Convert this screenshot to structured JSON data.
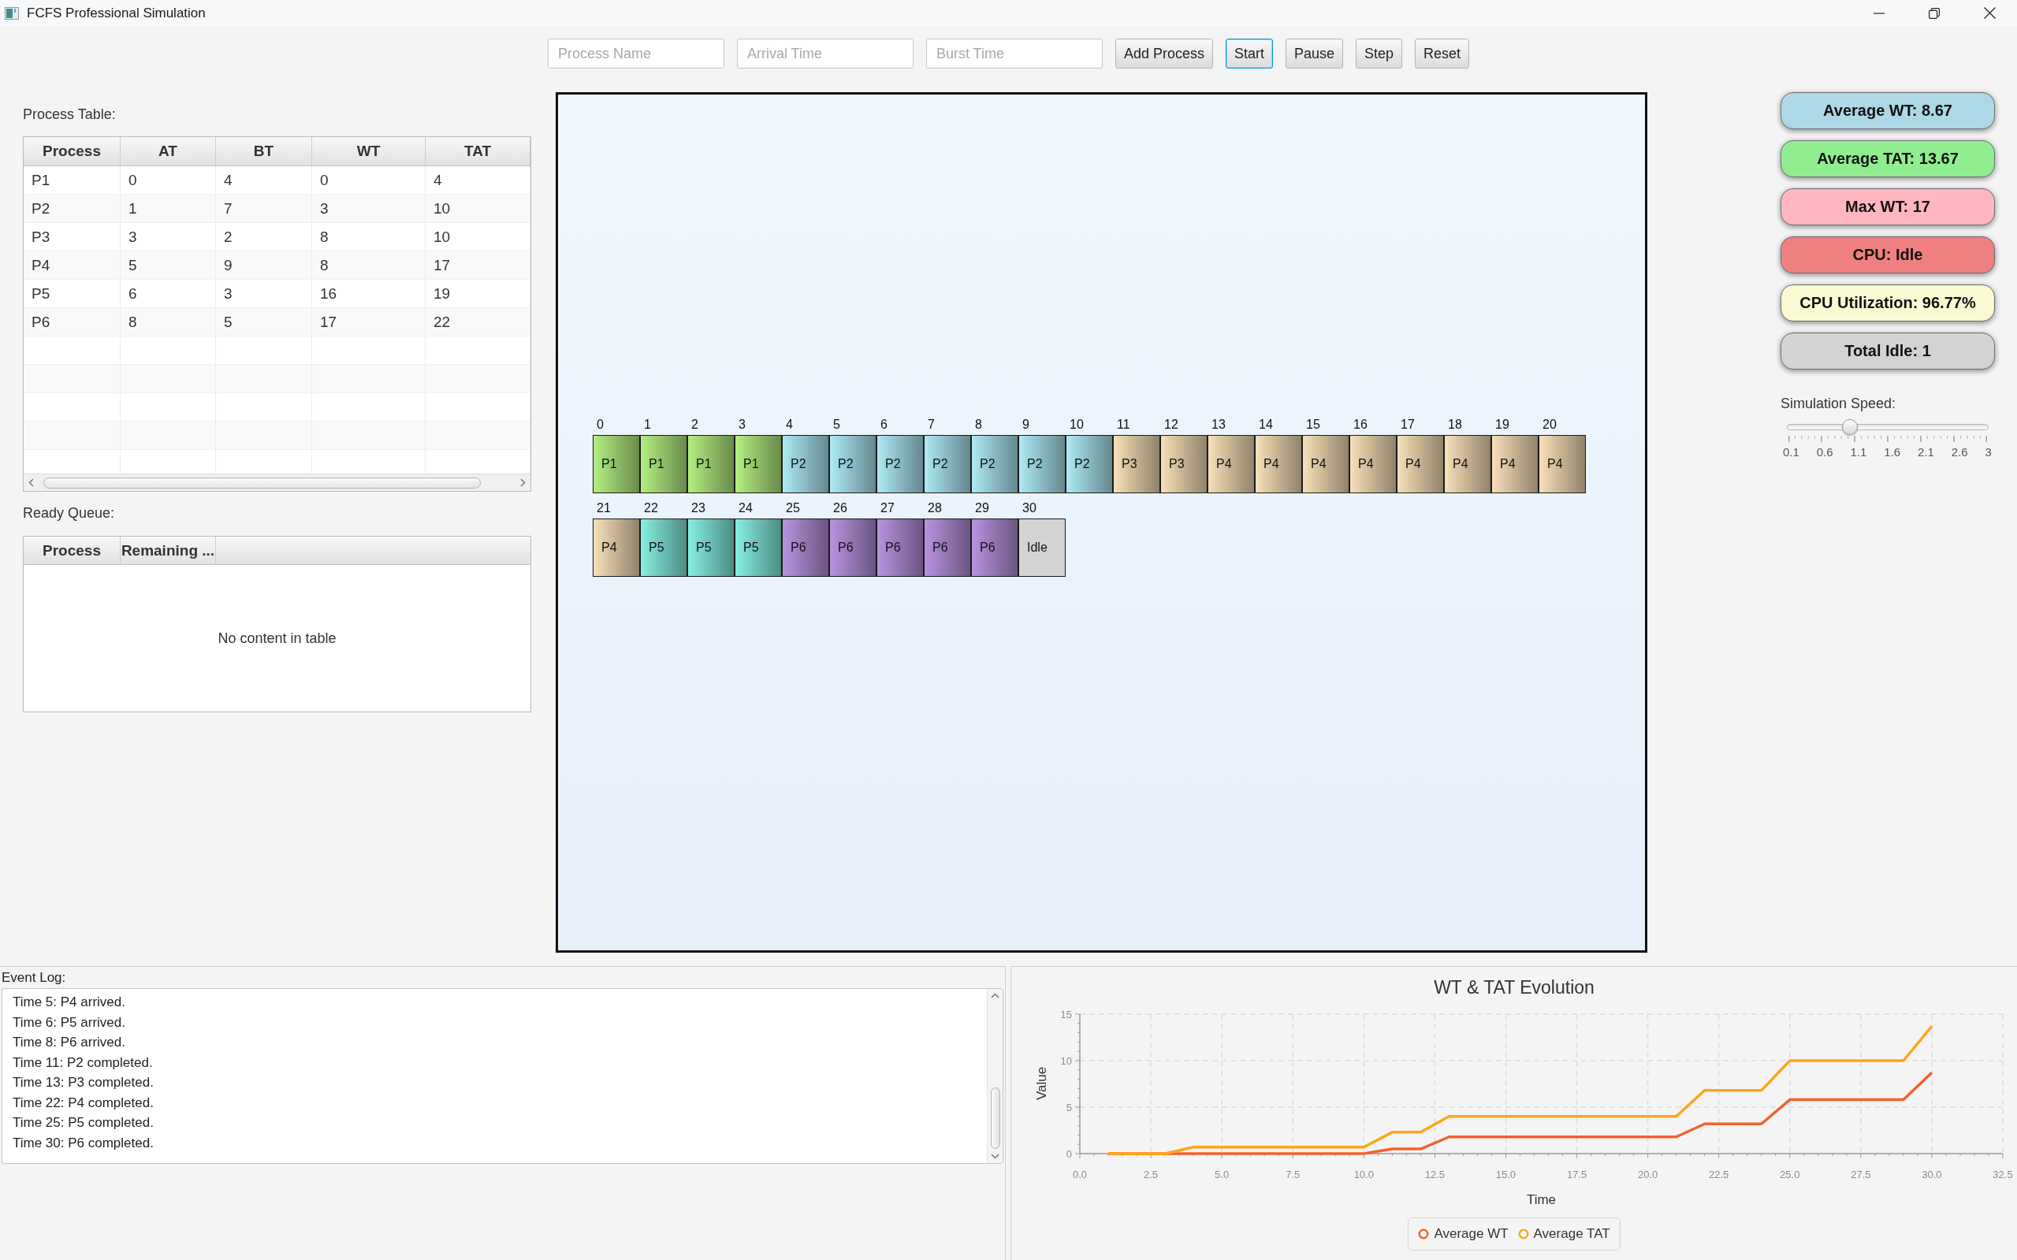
{
  "window": {
    "title": "FCFS Professional Simulation"
  },
  "toolbar": {
    "fields": [
      {
        "placeholder": "Process Name"
      },
      {
        "placeholder": "Arrival Time"
      },
      {
        "placeholder": "Burst Time"
      }
    ],
    "buttons": [
      {
        "label": "Add Process",
        "focused": false
      },
      {
        "label": "Start",
        "focused": true
      },
      {
        "label": "Pause",
        "focused": false
      },
      {
        "label": "Step",
        "focused": false
      },
      {
        "label": "Reset",
        "focused": false
      }
    ]
  },
  "process_table": {
    "label": "Process Table:",
    "columns": [
      "Process",
      "AT",
      "BT",
      "WT",
      "TAT"
    ],
    "rows": [
      [
        "P1",
        "0",
        "4",
        "0",
        "4"
      ],
      [
        "P2",
        "1",
        "7",
        "3",
        "10"
      ],
      [
        "P3",
        "3",
        "2",
        "8",
        "10"
      ],
      [
        "P4",
        "5",
        "9",
        "8",
        "17"
      ],
      [
        "P5",
        "6",
        "3",
        "16",
        "19"
      ],
      [
        "P6",
        "8",
        "5",
        "17",
        "22"
      ]
    ]
  },
  "ready_queue": {
    "label": "Ready Queue:",
    "columns": [
      "Process",
      "Remaining ..."
    ],
    "empty_text": "No content in table"
  },
  "gantt": {
    "slots": [
      {
        "time": "0",
        "label": "P1",
        "kind": "process",
        "color": "#b4ef82"
      },
      {
        "time": "1",
        "label": "P1",
        "kind": "process",
        "color": "#b4ef82"
      },
      {
        "time": "2",
        "label": "P1",
        "kind": "process",
        "color": "#b4ef82"
      },
      {
        "time": "3",
        "label": "P1",
        "kind": "process",
        "color": "#b4ef82"
      },
      {
        "time": "4",
        "label": "P2",
        "kind": "process",
        "color": "#aeeaf5"
      },
      {
        "time": "5",
        "label": "P2",
        "kind": "process",
        "color": "#aeeaf5"
      },
      {
        "time": "6",
        "label": "P2",
        "kind": "process",
        "color": "#aeeaf5"
      },
      {
        "time": "7",
        "label": "P2",
        "kind": "process",
        "color": "#aeeaf5"
      },
      {
        "time": "8",
        "label": "P2",
        "kind": "process",
        "color": "#aeeaf5"
      },
      {
        "time": "9",
        "label": "P2",
        "kind": "process",
        "color": "#aeeaf5"
      },
      {
        "time": "10",
        "label": "P2",
        "kind": "process",
        "color": "#aeeaf5"
      },
      {
        "time": "11",
        "label": "P3",
        "kind": "process",
        "color": "#f9e0b8"
      },
      {
        "time": "12",
        "label": "P3",
        "kind": "process",
        "color": "#f9e0b8"
      },
      {
        "time": "13",
        "label": "P4",
        "kind": "process",
        "color": "#f9e0b8"
      },
      {
        "time": "14",
        "label": "P4",
        "kind": "process",
        "color": "#f9e0b8"
      },
      {
        "time": "15",
        "label": "P4",
        "kind": "process",
        "color": "#f9e0b8"
      },
      {
        "time": "16",
        "label": "P4",
        "kind": "process",
        "color": "#f9e0b8"
      },
      {
        "time": "17",
        "label": "P4",
        "kind": "process",
        "color": "#f9e0b8"
      },
      {
        "time": "18",
        "label": "P4",
        "kind": "process",
        "color": "#f9e0b8"
      },
      {
        "time": "19",
        "label": "P4",
        "kind": "process",
        "color": "#f9e0b8"
      },
      {
        "time": "20",
        "label": "P4",
        "kind": "process",
        "color": "#f9e0b8"
      },
      {
        "time": "21",
        "label": "P4",
        "kind": "process",
        "color": "#f9e0b8"
      },
      {
        "time": "22",
        "label": "P5",
        "kind": "process",
        "color": "#86f0e2"
      },
      {
        "time": "23",
        "label": "P5",
        "kind": "process",
        "color": "#86f0e2"
      },
      {
        "time": "24",
        "label": "P5",
        "kind": "process",
        "color": "#86f0e2"
      },
      {
        "time": "25",
        "label": "P6",
        "kind": "process",
        "color": "#b893df"
      },
      {
        "time": "26",
        "label": "P6",
        "kind": "process",
        "color": "#b893df"
      },
      {
        "time": "27",
        "label": "P6",
        "kind": "process",
        "color": "#b893df"
      },
      {
        "time": "28",
        "label": "P6",
        "kind": "process",
        "color": "#b893df"
      },
      {
        "time": "29",
        "label": "P6",
        "kind": "process",
        "color": "#b893df"
      },
      {
        "time": "30",
        "label": "Idle",
        "kind": "idle",
        "color": "#d3d3d3"
      }
    ]
  },
  "stats": [
    {
      "text": "Average WT: 8.67",
      "color": "#add8e6"
    },
    {
      "text": "Average TAT: 13.67",
      "color": "#90ee90"
    },
    {
      "text": "Max WT: 17",
      "color": "#ffb6c1"
    },
    {
      "text": "CPU: Idle",
      "color": "#f08080"
    },
    {
      "text": "CPU Utilization: 96.77%",
      "color": "#fafad2"
    },
    {
      "text": "Total Idle: 1",
      "color": "#d3d3d3"
    }
  ],
  "speed": {
    "label": "Simulation Speed:",
    "level": 0.31,
    "tick_labels": [
      "0.1",
      "0.6",
      "1.1",
      "1.6",
      "2.1",
      "2.6",
      "3"
    ]
  },
  "event_log": {
    "label": "Event Log:",
    "lines": [
      "Time 5: P4 arrived.",
      "Time 6: P5 arrived.",
      "Time 8: P6 arrived.",
      "Time 11: P2 completed.",
      "Time 13: P3 completed.",
      "Time 22: P4 completed.",
      "Time 25: P5 completed.",
      "Time 30: P6 completed."
    ]
  },
  "wt_tat_chart": {
    "chart_data": {
      "type": "line",
      "title": "WT & TAT Evolution",
      "xlabel": "Time",
      "ylabel": "Value",
      "x": [
        1,
        2,
        3,
        4,
        5,
        6,
        7,
        8,
        9,
        10,
        11,
        12,
        13,
        14,
        15,
        16,
        17,
        18,
        19,
        20,
        21,
        22,
        23,
        24,
        25,
        26,
        27,
        28,
        29,
        30
      ],
      "series": [
        {
          "name": "Average WT",
          "color": "#f3622d",
          "values": [
            0,
            0,
            0,
            0,
            0,
            0,
            0,
            0,
            0,
            0,
            0.5,
            0.5,
            1.8,
            1.8,
            1.8,
            1.8,
            1.8,
            1.8,
            1.8,
            1.8,
            1.8,
            3.2,
            3.2,
            3.2,
            5.8,
            5.8,
            5.8,
            5.8,
            5.8,
            8.7
          ]
        },
        {
          "name": "Average TAT",
          "color": "#fba71b",
          "values": [
            0,
            0,
            0,
            0.7,
            0.7,
            0.7,
            0.7,
            0.7,
            0.7,
            0.7,
            2.3,
            2.3,
            4,
            4,
            4,
            4,
            4,
            4,
            4,
            4,
            4,
            6.8,
            6.8,
            6.8,
            10,
            10,
            10,
            10,
            10,
            13.7
          ]
        }
      ],
      "xlim": [
        0,
        32.5
      ],
      "ylim": [
        0,
        15
      ],
      "xticks": [
        {
          "value": 0,
          "label": "0.0"
        },
        {
          "value": 2.5,
          "label": "2.5"
        },
        {
          "value": 5,
          "label": "5.0"
        },
        {
          "value": 7.5,
          "label": "7.5"
        },
        {
          "value": 10,
          "label": "10.0"
        },
        {
          "value": 12.5,
          "label": "12.5"
        },
        {
          "value": 15,
          "label": "15.0"
        },
        {
          "value": 17.5,
          "label": "17.5"
        },
        {
          "value": 20,
          "label": "20.0"
        },
        {
          "value": 22.5,
          "label": "22.5"
        },
        {
          "value": 25,
          "label": "25.0"
        },
        {
          "value": 27.5,
          "label": "27.5"
        },
        {
          "value": 30,
          "label": "30.0"
        },
        {
          "value": 32.5,
          "label": "32.5"
        }
      ],
      "yticks": [
        0,
        5,
        10,
        15
      ],
      "grid": true,
      "legend": "bottom"
    }
  }
}
